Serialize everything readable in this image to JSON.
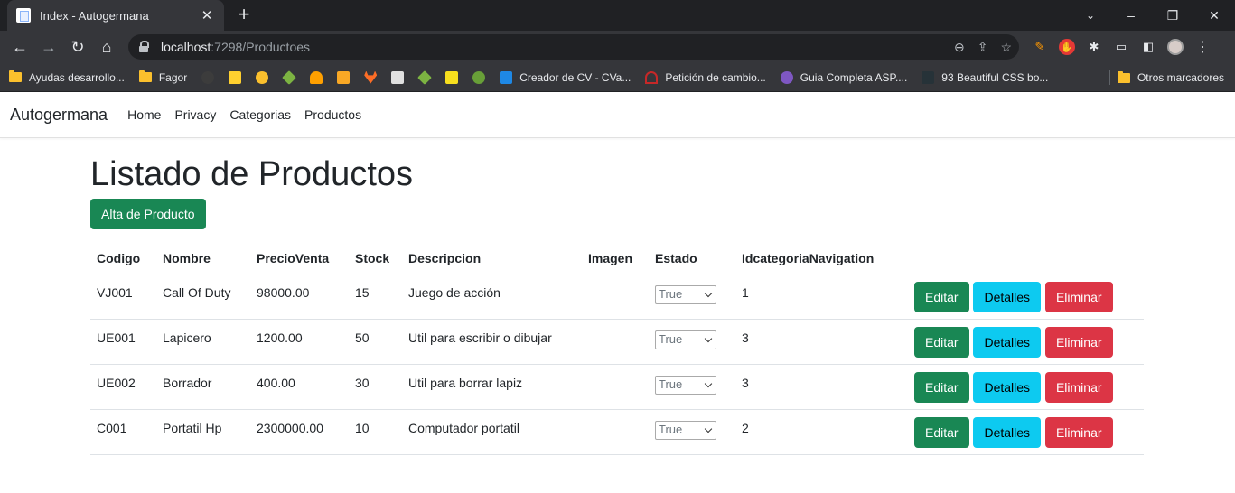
{
  "browser": {
    "tab_title": "Index - Autogermana",
    "url_host": "localhost",
    "url_path": ":7298/Productoes",
    "bookmarks": [
      {
        "label": "Ayudas desarrollo...",
        "type": "folder"
      },
      {
        "label": "Fagor",
        "type": "folder"
      },
      {
        "label": "",
        "type": "github-icon"
      },
      {
        "label": "",
        "type": "miro-icon"
      },
      {
        "label": "",
        "type": "emoji-icon"
      },
      {
        "label": "",
        "type": "diamond-icon"
      },
      {
        "label": "",
        "type": "firebase-icon"
      },
      {
        "label": "",
        "type": "stack-icon"
      },
      {
        "label": "",
        "type": "gitlab-icon"
      },
      {
        "label": "",
        "type": "search-icon"
      },
      {
        "label": "",
        "type": "diamond-icon"
      },
      {
        "label": "",
        "type": "js-icon"
      },
      {
        "label": "",
        "type": "globe-icon"
      },
      {
        "label": "Creador de CV - CVa...",
        "type": "cv-icon"
      },
      {
        "label": "Petición de cambio...",
        "type": "oracle-icon"
      },
      {
        "label": "Guia Completa ASP....",
        "type": "u-icon"
      },
      {
        "label": "93 Beautiful CSS bo...",
        "type": "css-icon"
      }
    ],
    "other_bookmarks": "Otros marcadores"
  },
  "navbar": {
    "brand": "Autogermana",
    "links": [
      "Home",
      "Privacy",
      "Categorias",
      "Productos"
    ]
  },
  "page": {
    "title": "Listado de Productos",
    "create_button": "Alta de Producto"
  },
  "table": {
    "headers": [
      "Codigo",
      "Nombre",
      "PrecioVenta",
      "Stock",
      "Descripcion",
      "Imagen",
      "Estado",
      "IdcategoriaNavigation"
    ],
    "rows": [
      {
        "codigo": "VJ001",
        "nombre": "Call Of Duty",
        "precio": "98000.00",
        "stock": "15",
        "descripcion": "Juego de acción",
        "imagen": "",
        "estado": "True",
        "categoria": "1"
      },
      {
        "codigo": "UE001",
        "nombre": "Lapicero",
        "precio": "1200.00",
        "stock": "50",
        "descripcion": "Util para escribir o dibujar",
        "imagen": "",
        "estado": "True",
        "categoria": "3"
      },
      {
        "codigo": "UE002",
        "nombre": "Borrador",
        "precio": "400.00",
        "stock": "30",
        "descripcion": "Util para borrar lapiz",
        "imagen": "",
        "estado": "True",
        "categoria": "3"
      },
      {
        "codigo": "C001",
        "nombre": "Portatil Hp",
        "precio": "2300000.00",
        "stock": "10",
        "descripcion": "Computador portatil",
        "imagen": "",
        "estado": "True",
        "categoria": "2"
      }
    ],
    "actions": {
      "edit": "Editar",
      "details": "Detalles",
      "delete": "Eliminar"
    }
  },
  "colors": {
    "success": "#198754",
    "info": "#0dcaf0",
    "danger": "#dc3545"
  }
}
